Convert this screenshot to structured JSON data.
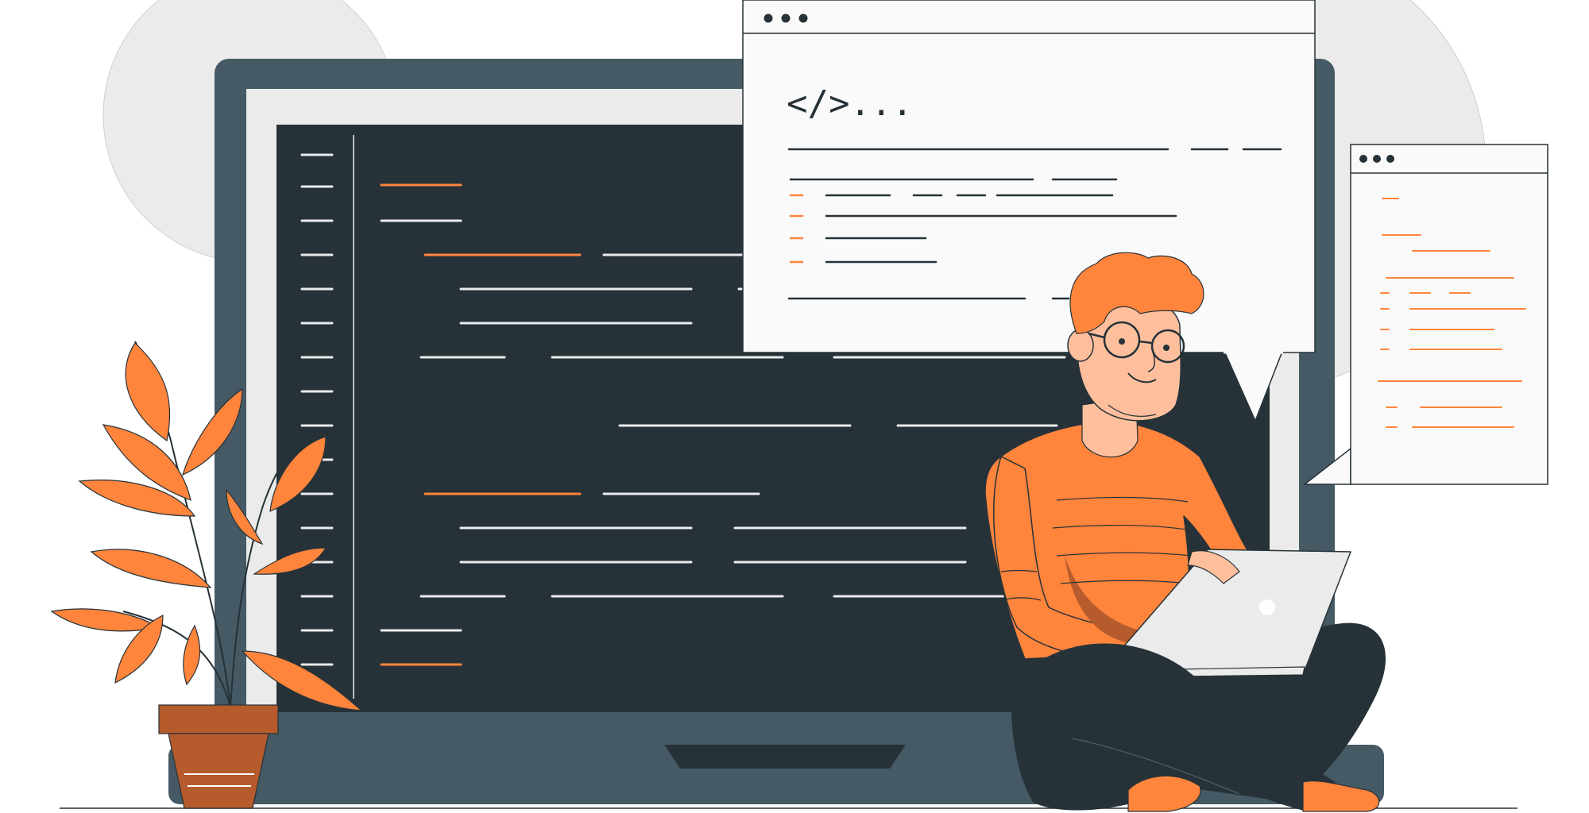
{
  "bubble": {
    "title_text": "</>..."
  },
  "colors": {
    "accent": "#ff843c",
    "accent_dark": "#b55b2c",
    "dark": "#263238",
    "slate": "#455a64",
    "light_gray": "#ebebeb",
    "window_bg": "#fafafa",
    "skin": "#ffbf9d"
  },
  "icons": {
    "window_dots": "three-dots-icon",
    "laptop_logo": "apple-like-logo-icon"
  }
}
